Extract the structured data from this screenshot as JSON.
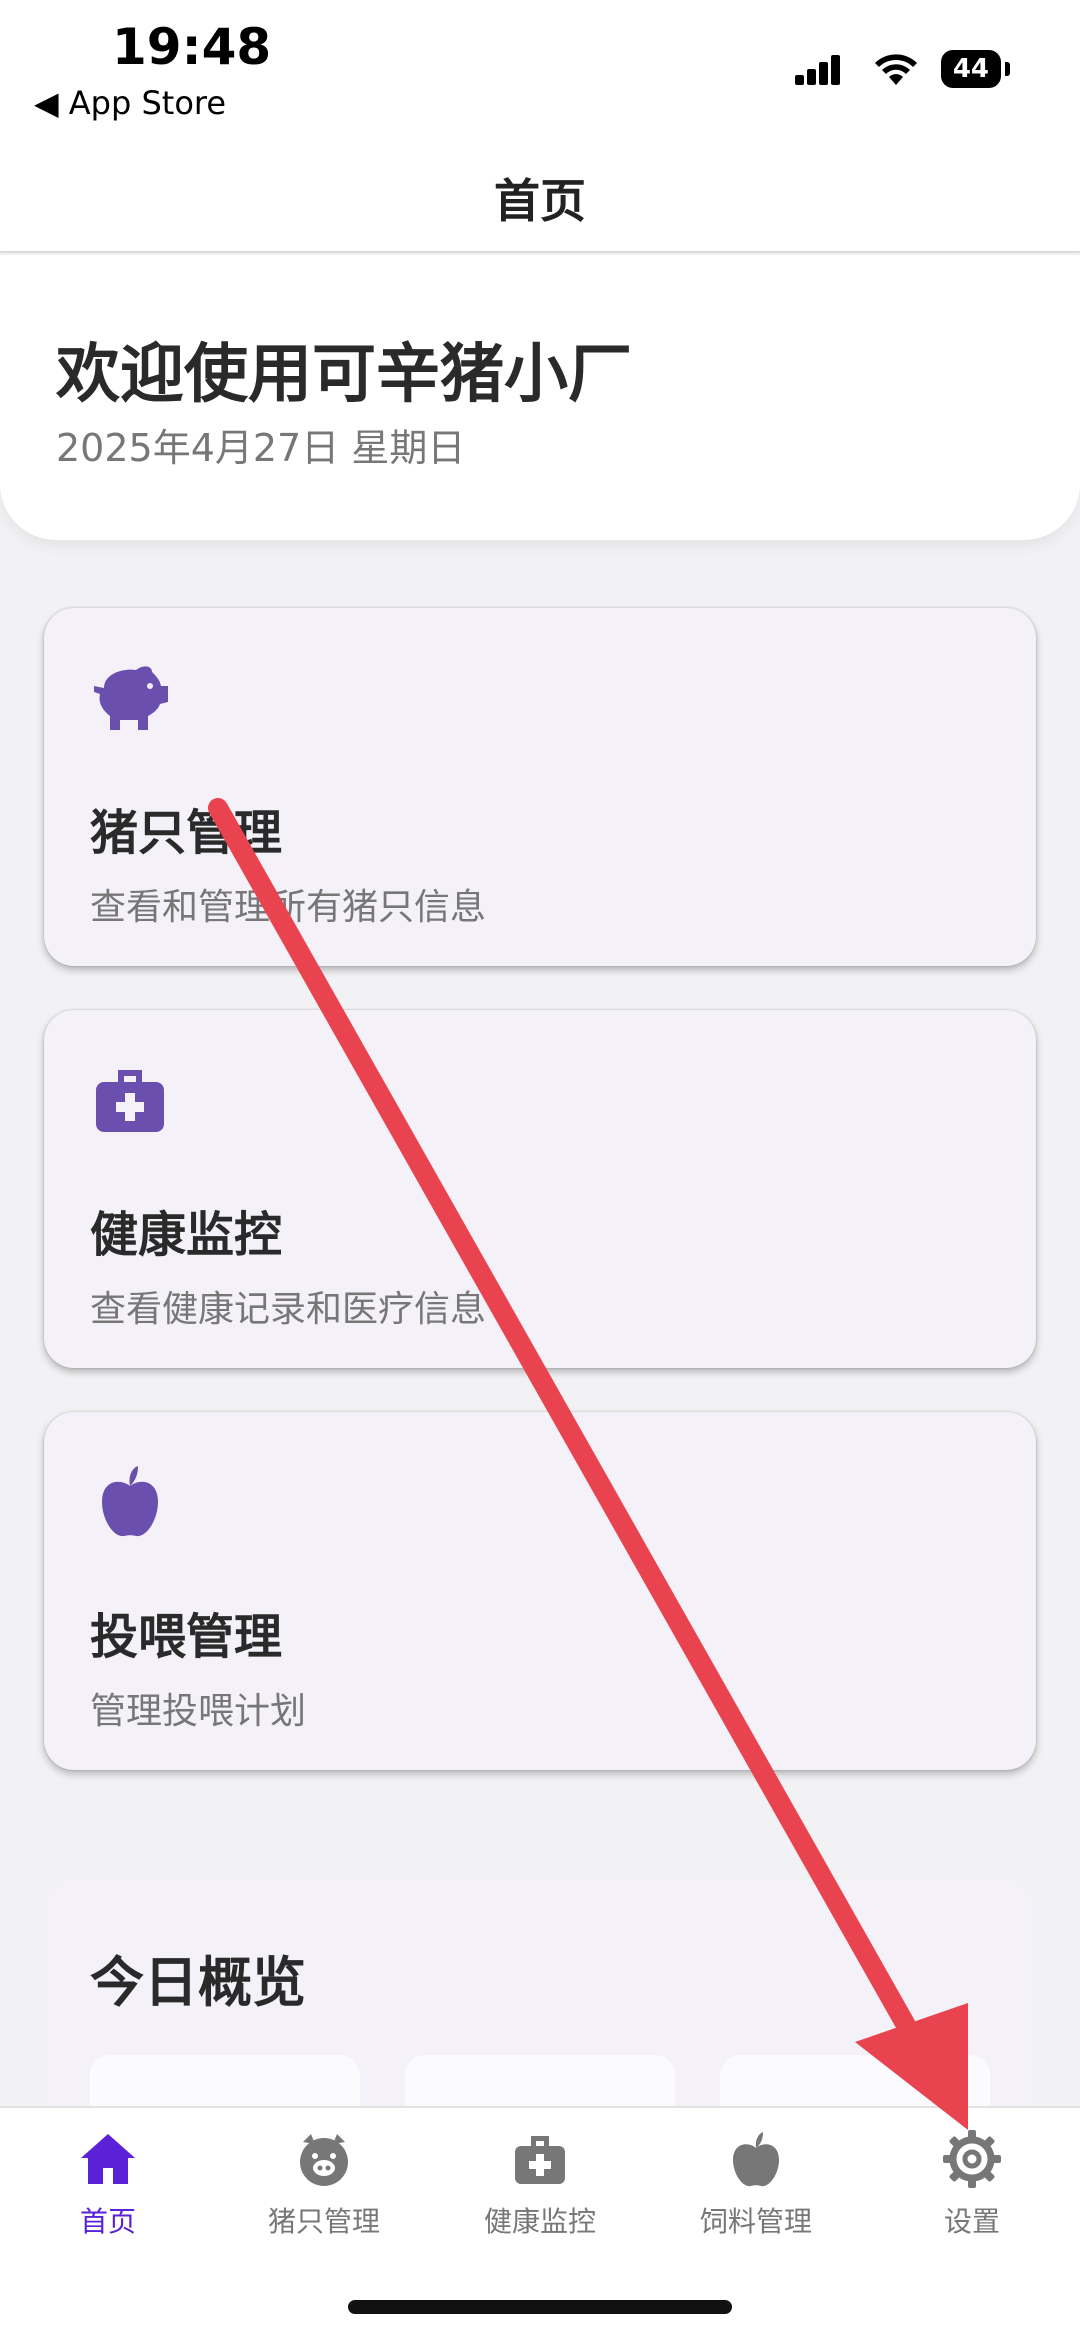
{
  "status_bar": {
    "time": "19:48",
    "back_label": "◀ App Store",
    "battery": "44"
  },
  "nav": {
    "title": "首页"
  },
  "welcome": {
    "title": "欢迎使用可辛猪小厂",
    "date": "2025年4月27日 星期日"
  },
  "cards": [
    {
      "title": "猪只管理",
      "description": "查看和管理所有猪只信息",
      "icon": "pig-icon"
    },
    {
      "title": "健康监控",
      "description": "查看健康记录和医疗信息",
      "icon": "medical-kit-icon"
    },
    {
      "title": "投喂管理",
      "description": "管理投喂计划",
      "icon": "apple-icon"
    }
  ],
  "overview": {
    "title": "今日概览"
  },
  "tabs": [
    {
      "label": "首页",
      "icon": "home-icon",
      "active": true
    },
    {
      "label": "猪只管理",
      "icon": "pig-icon",
      "active": false
    },
    {
      "label": "健康监控",
      "icon": "medical-kit-icon",
      "active": false
    },
    {
      "label": "饲料管理",
      "icon": "apple-icon",
      "active": false
    },
    {
      "label": "设置",
      "icon": "gear-icon",
      "active": false
    }
  ],
  "colors": {
    "accent": "#5b21d8",
    "icon_purple": "#6b4fae",
    "inactive_icon": "#777777",
    "annotation_red": "#e8434e"
  }
}
